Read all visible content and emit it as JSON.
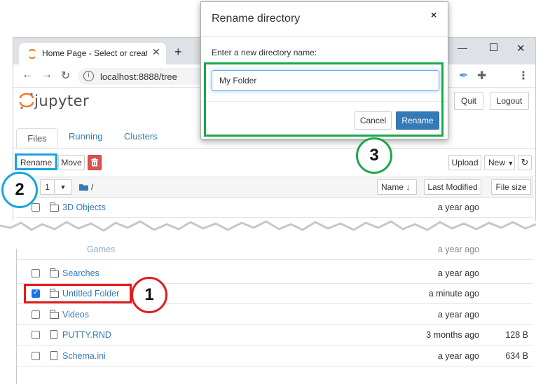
{
  "browser": {
    "tab_title": "Home Page - Select or create a n",
    "url": "localhost:8888/tree"
  },
  "jupyter": {
    "logo_text": "jupyter",
    "quit_label": "Quit",
    "logout_label": "Logout",
    "tabs": [
      "Files",
      "Running",
      "Clusters"
    ]
  },
  "toolbar": {
    "rename_label": "Rename",
    "move_label": "Move",
    "upload_label": "Upload",
    "new_label": "New",
    "selected_count": "1"
  },
  "list_header": {
    "breadcrumb": "/",
    "name_label": "Name",
    "modified_label": "Last Modified",
    "size_label": "File size"
  },
  "rows_top": [
    {
      "name": "3D Objects",
      "modified": "a year ago",
      "size": "",
      "type": "folder"
    }
  ],
  "rows_partial": [
    {
      "name": "Games",
      "modified": "a year ago",
      "size": "",
      "type": "folder"
    }
  ],
  "rows_bottom": [
    {
      "name": "Searches",
      "modified": "a year ago",
      "size": "",
      "type": "folder",
      "checked": false
    },
    {
      "name": "Untitled Folder",
      "modified": "a minute ago",
      "size": "",
      "type": "folder",
      "checked": true
    },
    {
      "name": "Videos",
      "modified": "a year ago",
      "size": "",
      "type": "folder",
      "checked": false
    },
    {
      "name": "PUTTY.RND",
      "modified": "3 months ago",
      "size": "128 B",
      "type": "file",
      "checked": false
    },
    {
      "name": "Schema.ini",
      "modified": "a year ago",
      "size": "634 B",
      "type": "file",
      "checked": false
    }
  ],
  "dialog": {
    "title": "Rename directory",
    "close_glyph": "×",
    "label": "Enter a new directory name:",
    "input_value": "My Folder",
    "cancel_label": "Cancel",
    "rename_label": "Rename"
  },
  "annotations": {
    "step1": "1",
    "step2": "2",
    "step3": "3",
    "colors": {
      "step1": "#e31b1b",
      "step2": "#1aa3e0",
      "step3": "#1aa84a"
    }
  },
  "icons": {
    "back": "back-arrow-icon",
    "forward": "forward-arrow-icon",
    "reload": "reload-icon",
    "trash": "trash-icon",
    "refresh": "refresh-icon",
    "folder": "folder-icon",
    "file": "file-icon"
  }
}
